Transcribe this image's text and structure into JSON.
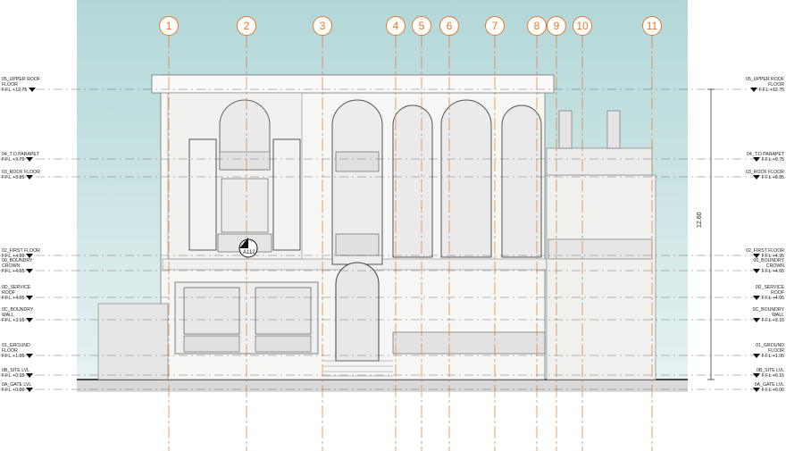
{
  "grid_lines": [
    "1",
    "2",
    "3",
    "4",
    "5",
    "6",
    "7",
    "8",
    "9",
    "10",
    "11"
  ],
  "levels": [
    {
      "name": "05_UPPER ROOF\nFLOOR",
      "ffl": "F.F.L +12.75",
      "side_left": true,
      "side_right": true
    },
    {
      "name": "04_T.O PARAPET",
      "ffl": "F.F.L +9.75",
      "side_left": true,
      "side_right": true
    },
    {
      "name": "03_ROOF FLOOR",
      "ffl": "F.F.L +8.85",
      "side_left": true,
      "side_right": true
    },
    {
      "name": "02_FIRST FLOOR",
      "ffl": "F.F.L +4.95",
      "side_left": true,
      "side_right": true
    },
    {
      "name": "00_BOUNDRY\nCROWN",
      "ffl": "F.F.L +4.65",
      "side_left": true,
      "side_right": true
    },
    {
      "name": "0D_SERVICE\nROOF",
      "ffl": "F.F.L +4.05",
      "side_left": true,
      "side_right": true
    },
    {
      "name": "0C_BOUNDRY\nWALL",
      "ffl": "F.F.L +3.15",
      "side_left": true,
      "side_right": true
    },
    {
      "name": "01_GROUND\nFLOOR",
      "ffl": "F.F.L +1.05",
      "side_left": true,
      "side_right": true
    },
    {
      "name": "0B_SITE LVL",
      "ffl": "F.F.L +0.15",
      "side_left": true,
      "side_right": true
    },
    {
      "name": "0A_GATE LVL",
      "ffl": "F.F.L +0.00",
      "side_left": true,
      "side_right": true
    }
  ],
  "dimension": "12.60",
  "section_tag": "A112",
  "colors": {
    "grid": "#e07a2e",
    "sky": "#b9dcdc",
    "line": "#333333"
  }
}
